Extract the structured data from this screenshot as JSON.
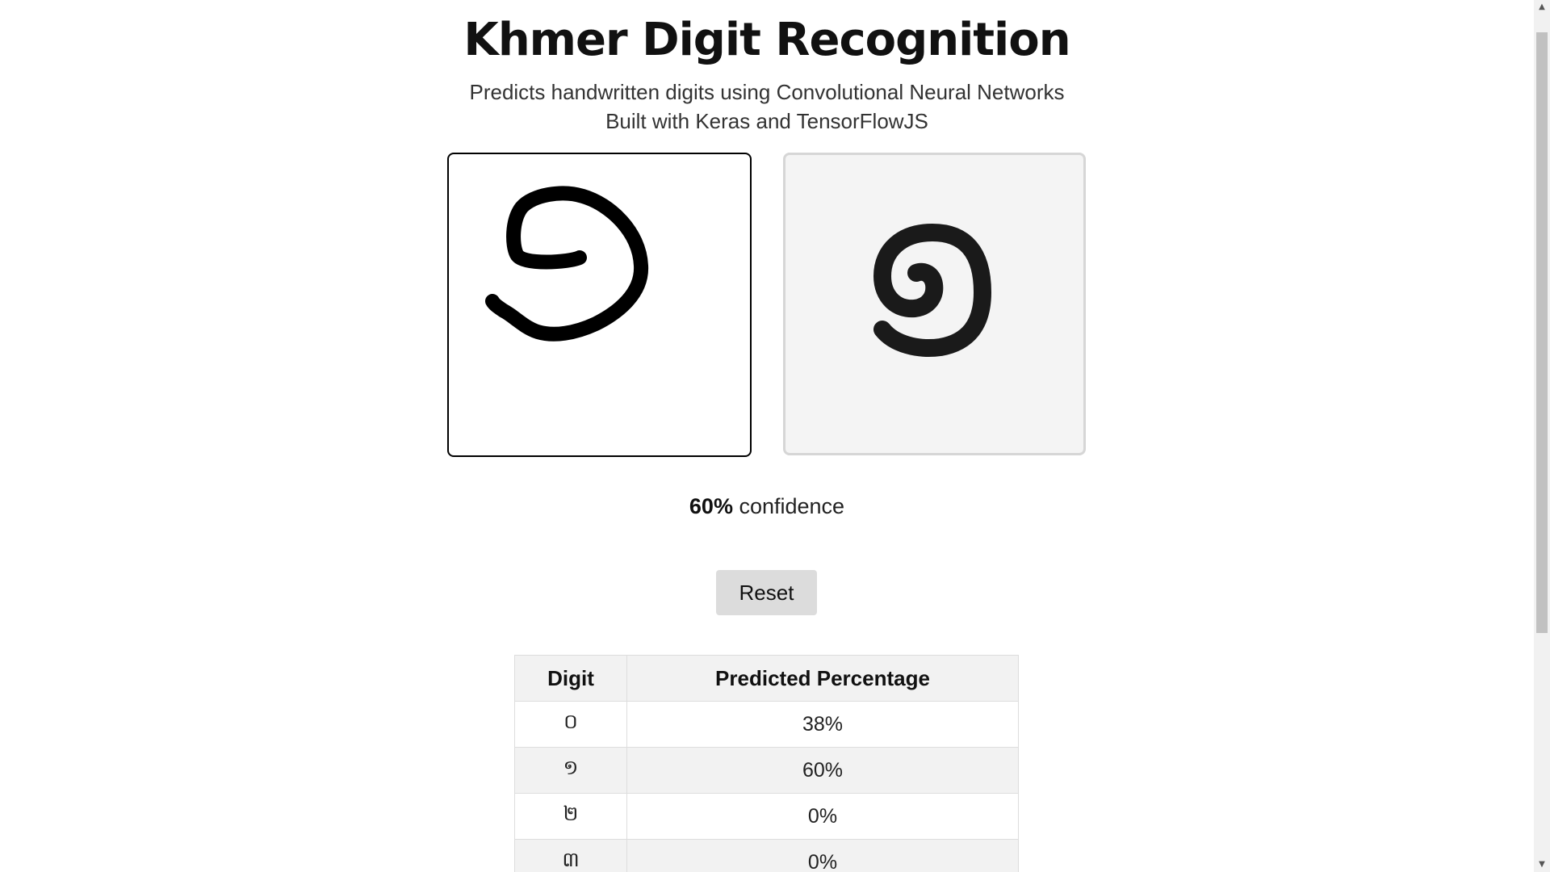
{
  "header": {
    "title": "Khmer Digit Recognition",
    "subtitle_line1": "Predicts handwritten digits using Convolutional Neural Networks",
    "subtitle_line2": "Built with Keras and TensorFlowJS"
  },
  "prediction": {
    "digit": "១",
    "confidence_value": "60%",
    "confidence_label": "confidence"
  },
  "controls": {
    "reset_label": "Reset"
  },
  "table": {
    "headers": [
      "Digit",
      "Predicted Percentage"
    ],
    "rows": [
      {
        "digit": "០",
        "percentage": "38%"
      },
      {
        "digit": "១",
        "percentage": "60%"
      },
      {
        "digit": "២",
        "percentage": "0%"
      },
      {
        "digit": "៣",
        "percentage": "0%"
      }
    ]
  },
  "icons": {
    "scroll_up": "triangle-up-icon",
    "scroll_down": "triangle-down-icon"
  },
  "colors": {
    "canvas_border": "#000000",
    "prediction_bg": "#f4f4f4",
    "button_bg": "#dcdcdc"
  }
}
